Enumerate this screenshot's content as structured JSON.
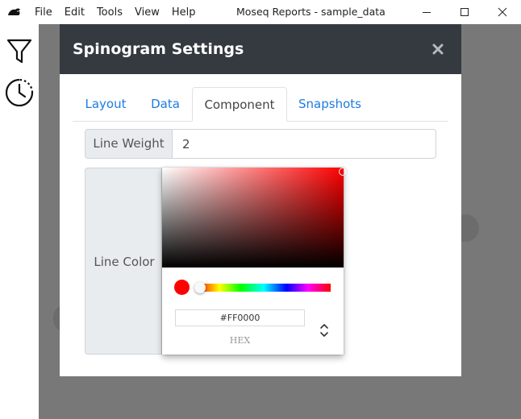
{
  "window": {
    "title": "Moseq Reports - sample_data",
    "menu": [
      "File",
      "Edit",
      "Tools",
      "View",
      "Help"
    ]
  },
  "sidebar": {
    "icons": [
      "filter-icon",
      "history-icon"
    ]
  },
  "modal": {
    "title": "Spinogram Settings",
    "tabs": [
      {
        "label": "Layout",
        "active": false
      },
      {
        "label": "Data",
        "active": false
      },
      {
        "label": "Component",
        "active": true
      },
      {
        "label": "Snapshots",
        "active": false
      }
    ],
    "line_weight": {
      "label": "Line Weight",
      "value": "2"
    },
    "line_color": {
      "label": "Line Color"
    }
  },
  "color_picker": {
    "hex_value": "#FF0000",
    "mode_label": "HEX",
    "current_color": "#ff0000"
  },
  "colors": {
    "modal_header": "#343a40",
    "tab_link": "#1d7be1",
    "overlay": "#787878"
  }
}
